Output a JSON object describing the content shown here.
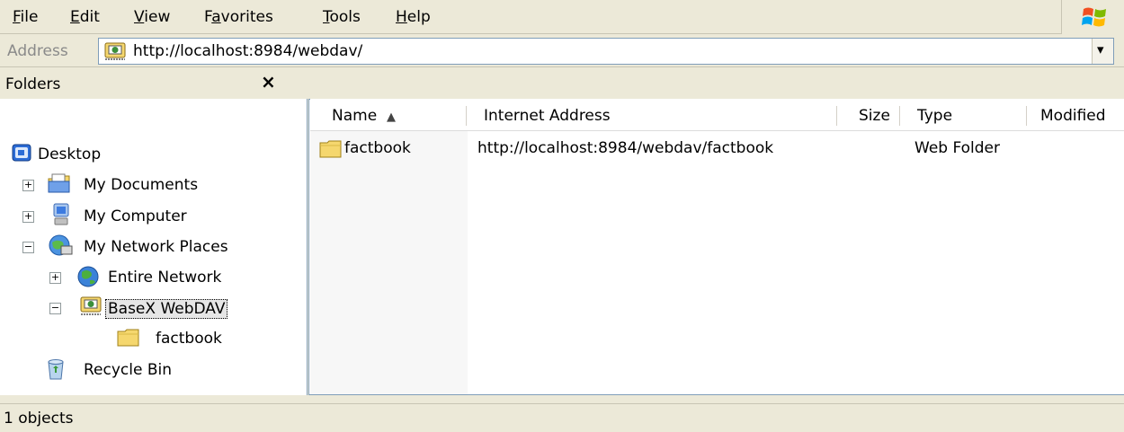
{
  "menu": {
    "items": [
      {
        "label": "File",
        "accel": "F",
        "rest": "ile"
      },
      {
        "label": "Edit",
        "accel": "E",
        "rest": "dit"
      },
      {
        "label": "View",
        "accel": "V",
        "rest": "iew"
      },
      {
        "label": "Favorites",
        "pre": "F",
        "accel": "a",
        "rest": "vorites"
      },
      {
        "label": "Tools",
        "accel": "T",
        "rest": "ools"
      },
      {
        "label": "Help",
        "accel": "H",
        "rest": "elp"
      }
    ]
  },
  "address": {
    "label": "Address",
    "value": "http://localhost:8984/webdav/"
  },
  "folders": {
    "title": "Folders",
    "close": "×",
    "tree": [
      {
        "label": "Desktop",
        "icon": "desktop-icon"
      },
      {
        "label": "My Documents",
        "icon": "my-documents-icon",
        "expander": "+"
      },
      {
        "label": "My Computer",
        "icon": "my-computer-icon",
        "expander": "+"
      },
      {
        "label": "My Network Places",
        "icon": "network-places-icon",
        "expander": "−"
      },
      {
        "label": "Entire Network",
        "icon": "globe-icon",
        "expander": "+"
      },
      {
        "label": "BaseX WebDAV",
        "icon": "web-folder-icon",
        "expander": "−"
      },
      {
        "label": "factbook",
        "icon": "folder-icon"
      },
      {
        "label": "Recycle Bin",
        "icon": "recycle-bin-icon"
      }
    ]
  },
  "list": {
    "columns": [
      "Name",
      "Internet Address",
      "Size",
      "Type",
      "Modified"
    ],
    "sort_indicator": "▲",
    "rows": [
      {
        "name": "factbook",
        "address": "http://localhost:8984/webdav/factbook",
        "size": "",
        "type": "Web Folder",
        "modified": ""
      }
    ]
  },
  "status": {
    "text": "1 objects"
  },
  "colors": {
    "chrome": "#ece9d8",
    "border": "#7f9db9",
    "folder": "#f5d76e"
  }
}
